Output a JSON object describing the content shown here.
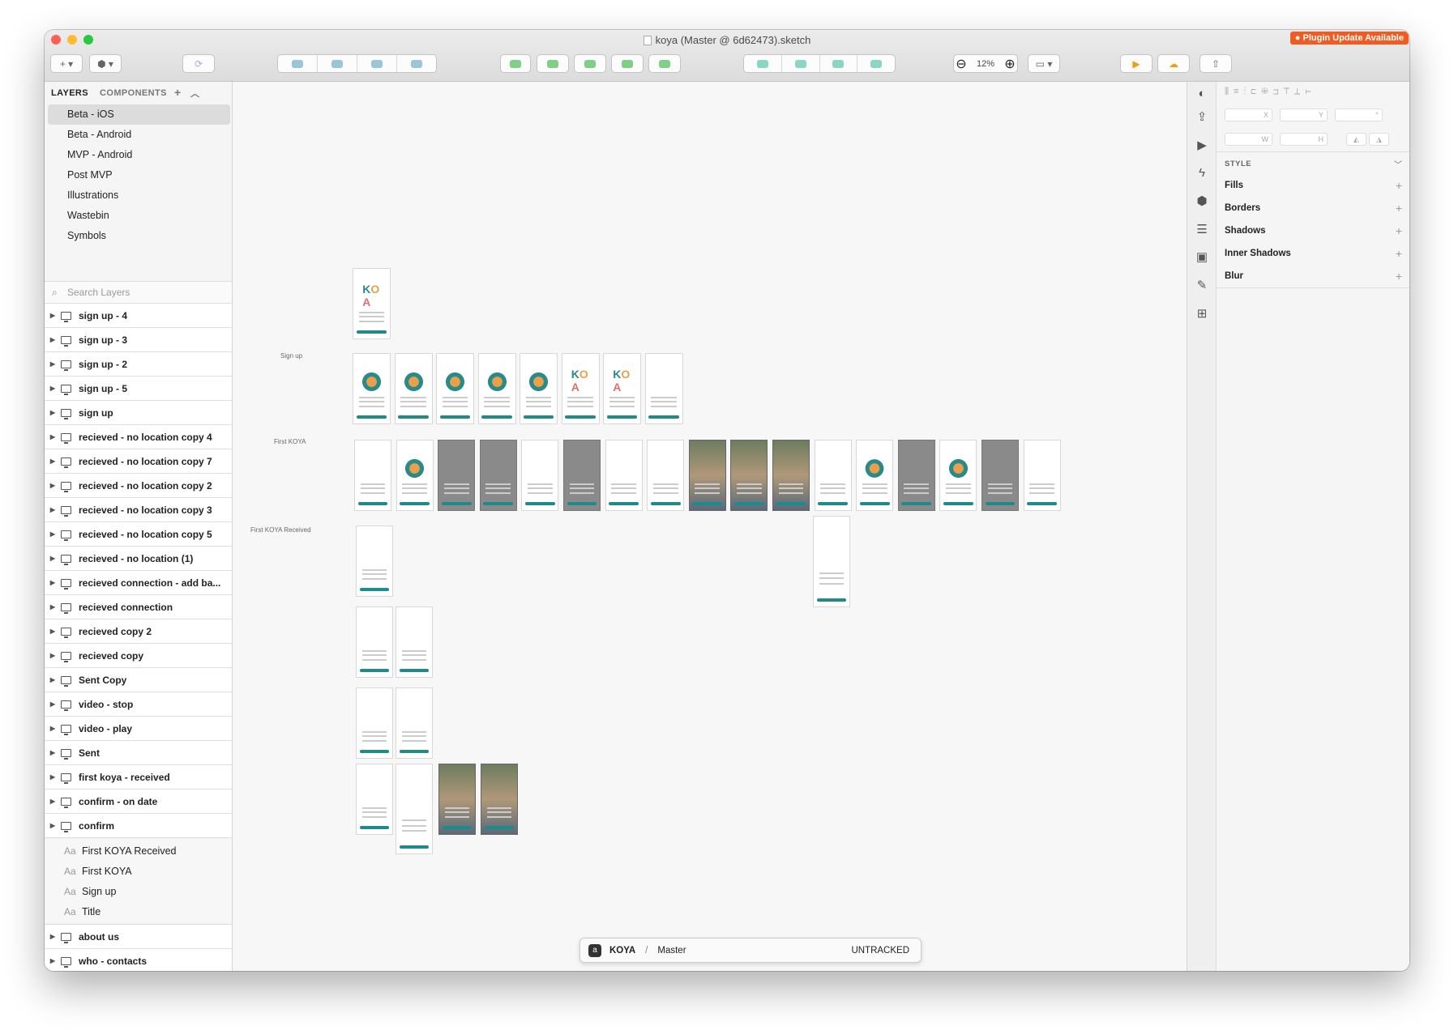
{
  "window": {
    "title": "koya (Master @ 6d62473).sketch",
    "plugin_badge": "Plugin Update Available"
  },
  "toolbar": {
    "zoom": "12%"
  },
  "left_panel": {
    "tabs": [
      "LAYERS",
      "COMPONENTS"
    ],
    "pages": [
      "Beta - iOS",
      "Beta - Android",
      "MVP - Android",
      "Post MVP",
      "Illustrations",
      "Wastebin",
      "Symbols"
    ],
    "search_placeholder": "Search Layers",
    "layers": [
      "sign up - 4",
      "sign up - 3",
      "sign up - 2",
      "sign up - 5",
      "sign up",
      "recieved - no location copy 4",
      "recieved - no location copy 7",
      "recieved - no location copy 2",
      "recieved - no location copy 3",
      "recieved - no location copy 5",
      "recieved - no location (1)",
      "recieved connection - add ba...",
      "recieved connection",
      "recieved copy 2",
      "recieved copy",
      "Sent Copy",
      "video - stop",
      "video - play",
      "Sent",
      "first koya - received",
      "confirm - on date",
      "confirm"
    ],
    "text_layers": [
      "First KOYA Received",
      "First KOYA",
      "Sign up",
      "Title"
    ],
    "layers_after": [
      "about us",
      "who - contacts"
    ]
  },
  "canvas": {
    "labels": {
      "sign_up": "Sign up",
      "first_koya": "First KOYA",
      "first_koya_received": "First KOYA Received"
    },
    "branch": {
      "project": "KOYA",
      "separator": "/",
      "branch": "Master",
      "status": "UNTRACKED"
    }
  },
  "inspector": {
    "fields": {
      "x": "X",
      "y": "Y",
      "angle": "°",
      "w": "W",
      "h": "H"
    },
    "style_label": "STYLE",
    "sections": [
      "Fills",
      "Borders",
      "Shadows",
      "Inner Shadows",
      "Blur"
    ]
  },
  "colors": {
    "accent": "#1f8a8a",
    "plugin": "#f25a1f"
  }
}
